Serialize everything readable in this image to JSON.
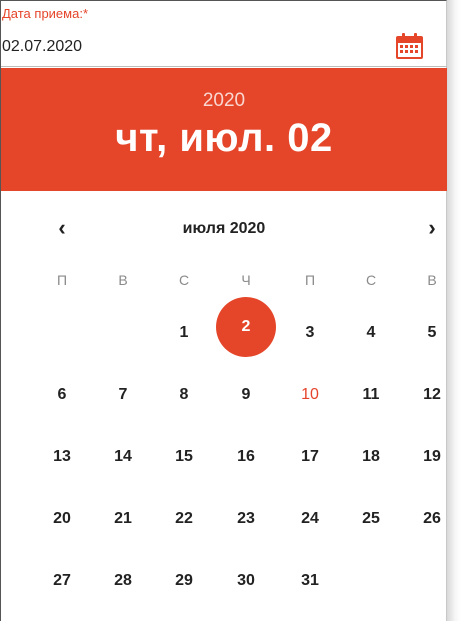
{
  "field": {
    "label": "Дата приема:*",
    "value": "02.07.2020",
    "icon": "calendar-icon"
  },
  "header": {
    "year": "2020",
    "date": "чт, июл. 02"
  },
  "nav": {
    "month": "июля 2020",
    "prev": "‹",
    "next": "›"
  },
  "weekdays": [
    "П",
    "В",
    "С",
    "Ч",
    "П",
    "С",
    "В"
  ],
  "weeks": [
    [
      "",
      "",
      "1",
      "2",
      "3",
      "4",
      "5"
    ],
    [
      "6",
      "7",
      "8",
      "9",
      "10",
      "11",
      "12"
    ],
    [
      "13",
      "14",
      "15",
      "16",
      "17",
      "18",
      "19"
    ],
    [
      "20",
      "21",
      "22",
      "23",
      "24",
      "25",
      "26"
    ],
    [
      "27",
      "28",
      "29",
      "30",
      "31",
      "",
      ""
    ]
  ],
  "selected_day": "2",
  "highlighted_day": "10",
  "colors": {
    "accent": "#e5462a",
    "label": "#e5442a",
    "text": "#222222",
    "weekday": "#8a8a8a"
  }
}
